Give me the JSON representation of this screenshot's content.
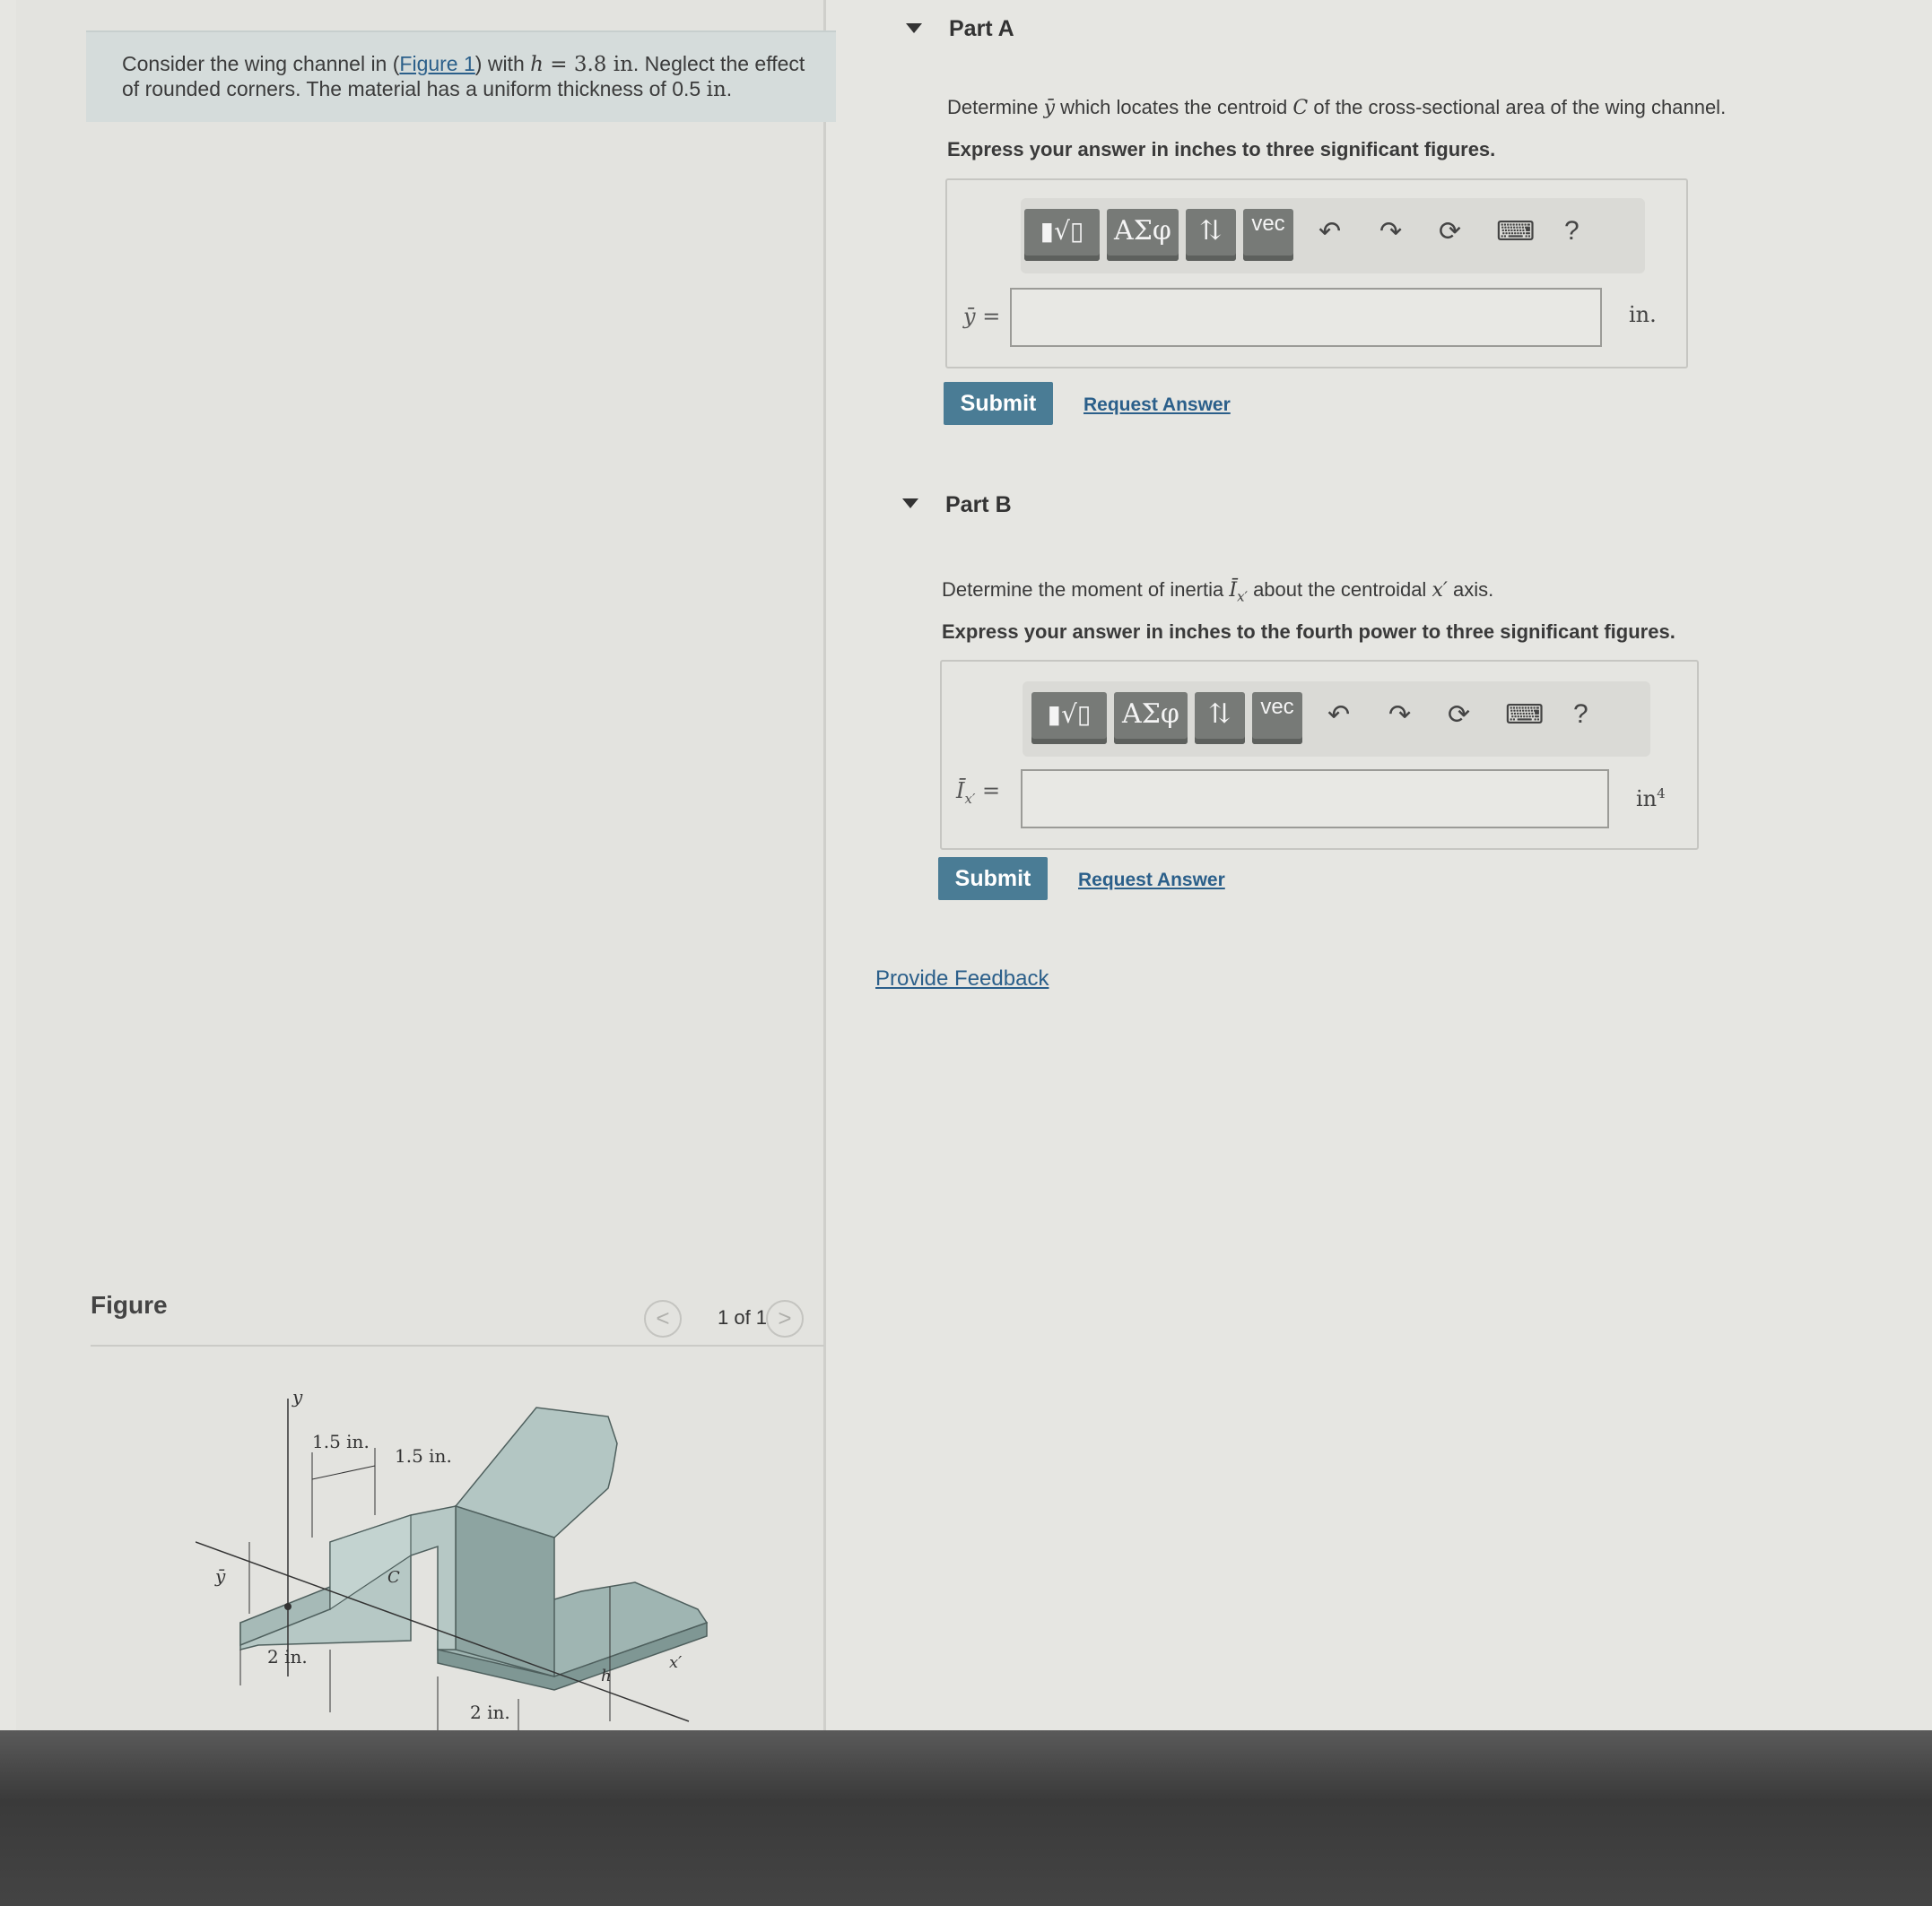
{
  "prompt": {
    "text_1": "Consider the wing channel in (",
    "figure_link": "Figure 1",
    "text_2": ") with ",
    "h_var": "h",
    "h_value": " = 3.8 in",
    "text_3": ". Neglect the effect of rounded corners. The material has a uniform thickness of 0.5 ",
    "thickness_unit": "in",
    "text_4": "."
  },
  "figure": {
    "title": "Figure",
    "pager": {
      "prev": "<",
      "count": "1 of 1",
      "next": ">"
    },
    "labels": {
      "y": "y",
      "ybar": "ȳ",
      "c": "C",
      "h": "h",
      "xprime": "x′",
      "dim_15_a": "1.5 in.",
      "dim_15_b": "1.5 in.",
      "dim_2_a": "2 in.",
      "dim_2_b": "2 in."
    },
    "colors": {
      "fill": "#9fb5b2",
      "fill_dark": "#8aa19e",
      "fill_light": "#b7c9c6",
      "stroke": "#4e5f5d"
    }
  },
  "parts": [
    {
      "title": "Part A",
      "question_1": "Determine ",
      "question_var": "ȳ",
      "question_2": " which locates the centroid ",
      "question_var2": "C",
      "question_3": " of the cross-sectional area of the wing channel.",
      "instruction": "Express your answer in inches to three significant figures.",
      "toolbar": {
        "templates": "▮√▯",
        "greek": "ΑΣφ",
        "arrows": "⇅",
        "vec": "vec",
        "undo": "↶",
        "redo": "↷",
        "reset": "⟳",
        "keyboard": "⌨",
        "help": "?"
      },
      "variable": "ȳ =",
      "input_value": "",
      "unit": "in.",
      "submit": "Submit",
      "request": "Request Answer"
    },
    {
      "title": "Part B",
      "question_1": "Determine the moment of inertia ",
      "question_var": "Ī",
      "question_sub": "x′",
      "question_2": " about the centroidal ",
      "question_var2": "x′",
      "question_3": " axis.",
      "instruction": "Express your answer in inches to the fourth power to three significant figures.",
      "toolbar": {
        "templates": "▮√▯",
        "greek": "ΑΣφ",
        "arrows": "⇅",
        "vec": "vec",
        "undo": "↶",
        "redo": "↷",
        "reset": "⟳",
        "keyboard": "⌨",
        "help": "?"
      },
      "variable": "Ī",
      "variable_sub": "x′",
      "variable_eq": " =",
      "input_value": "",
      "unit": "in",
      "unit_sup": "4",
      "submit": "Submit",
      "request": "Request Answer"
    }
  ],
  "feedback": "Provide Feedback"
}
